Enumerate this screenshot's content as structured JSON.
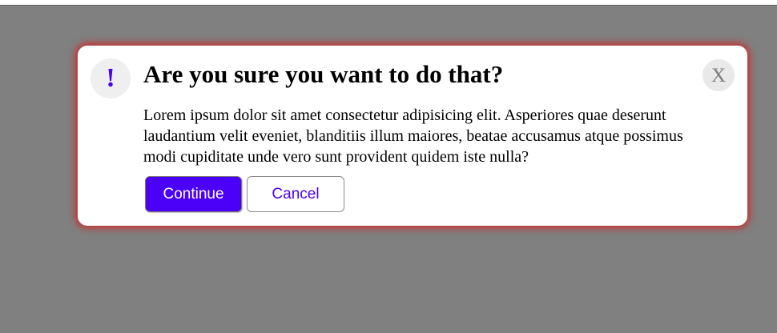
{
  "dialog": {
    "alert_icon": "exclamation-icon",
    "alert_glyph": "!",
    "title": "Are you sure you want to do that?",
    "message": "Lorem ipsum dolor sit amet consectetur adipisicing elit. Asperiores quae deserunt laudantium velit eveniet, blanditiis illum maiores, beatae accusamus atque possimus modi cupiditate unde vero sunt provident quidem iste nulla?",
    "close_icon": "close-icon",
    "close_glyph": "X",
    "continue_label": "Continue",
    "cancel_label": "Cancel"
  },
  "colors": {
    "accent": "#4b00f7",
    "overlay": "#808080",
    "dialog_glow": "#d61d1d",
    "dialog_background": "#ffffff"
  }
}
